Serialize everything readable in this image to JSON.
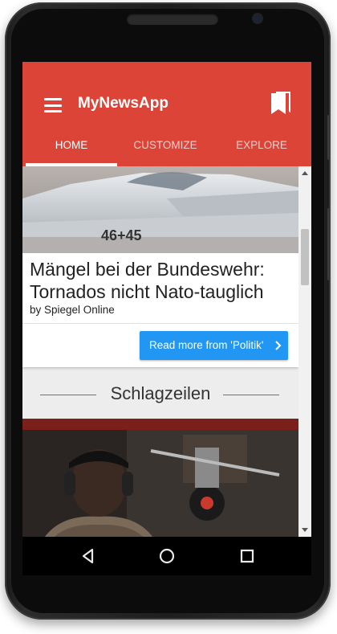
{
  "app": {
    "title": "MyNewsApp"
  },
  "tabs": [
    {
      "label": "HOME"
    },
    {
      "label": "CUSTOMIZE"
    },
    {
      "label": "EXPLORE"
    }
  ],
  "article": {
    "headline": "Mängel bei der Bundeswehr: Tornados nicht Nato-tauglich",
    "source": "by Spiegel Online",
    "read_more": "Read more from 'Politik'",
    "image_text": "46+45"
  },
  "section": {
    "title": "Schlagzeilen"
  },
  "colors": {
    "accent": "#db4437",
    "button": "#2196f3"
  }
}
